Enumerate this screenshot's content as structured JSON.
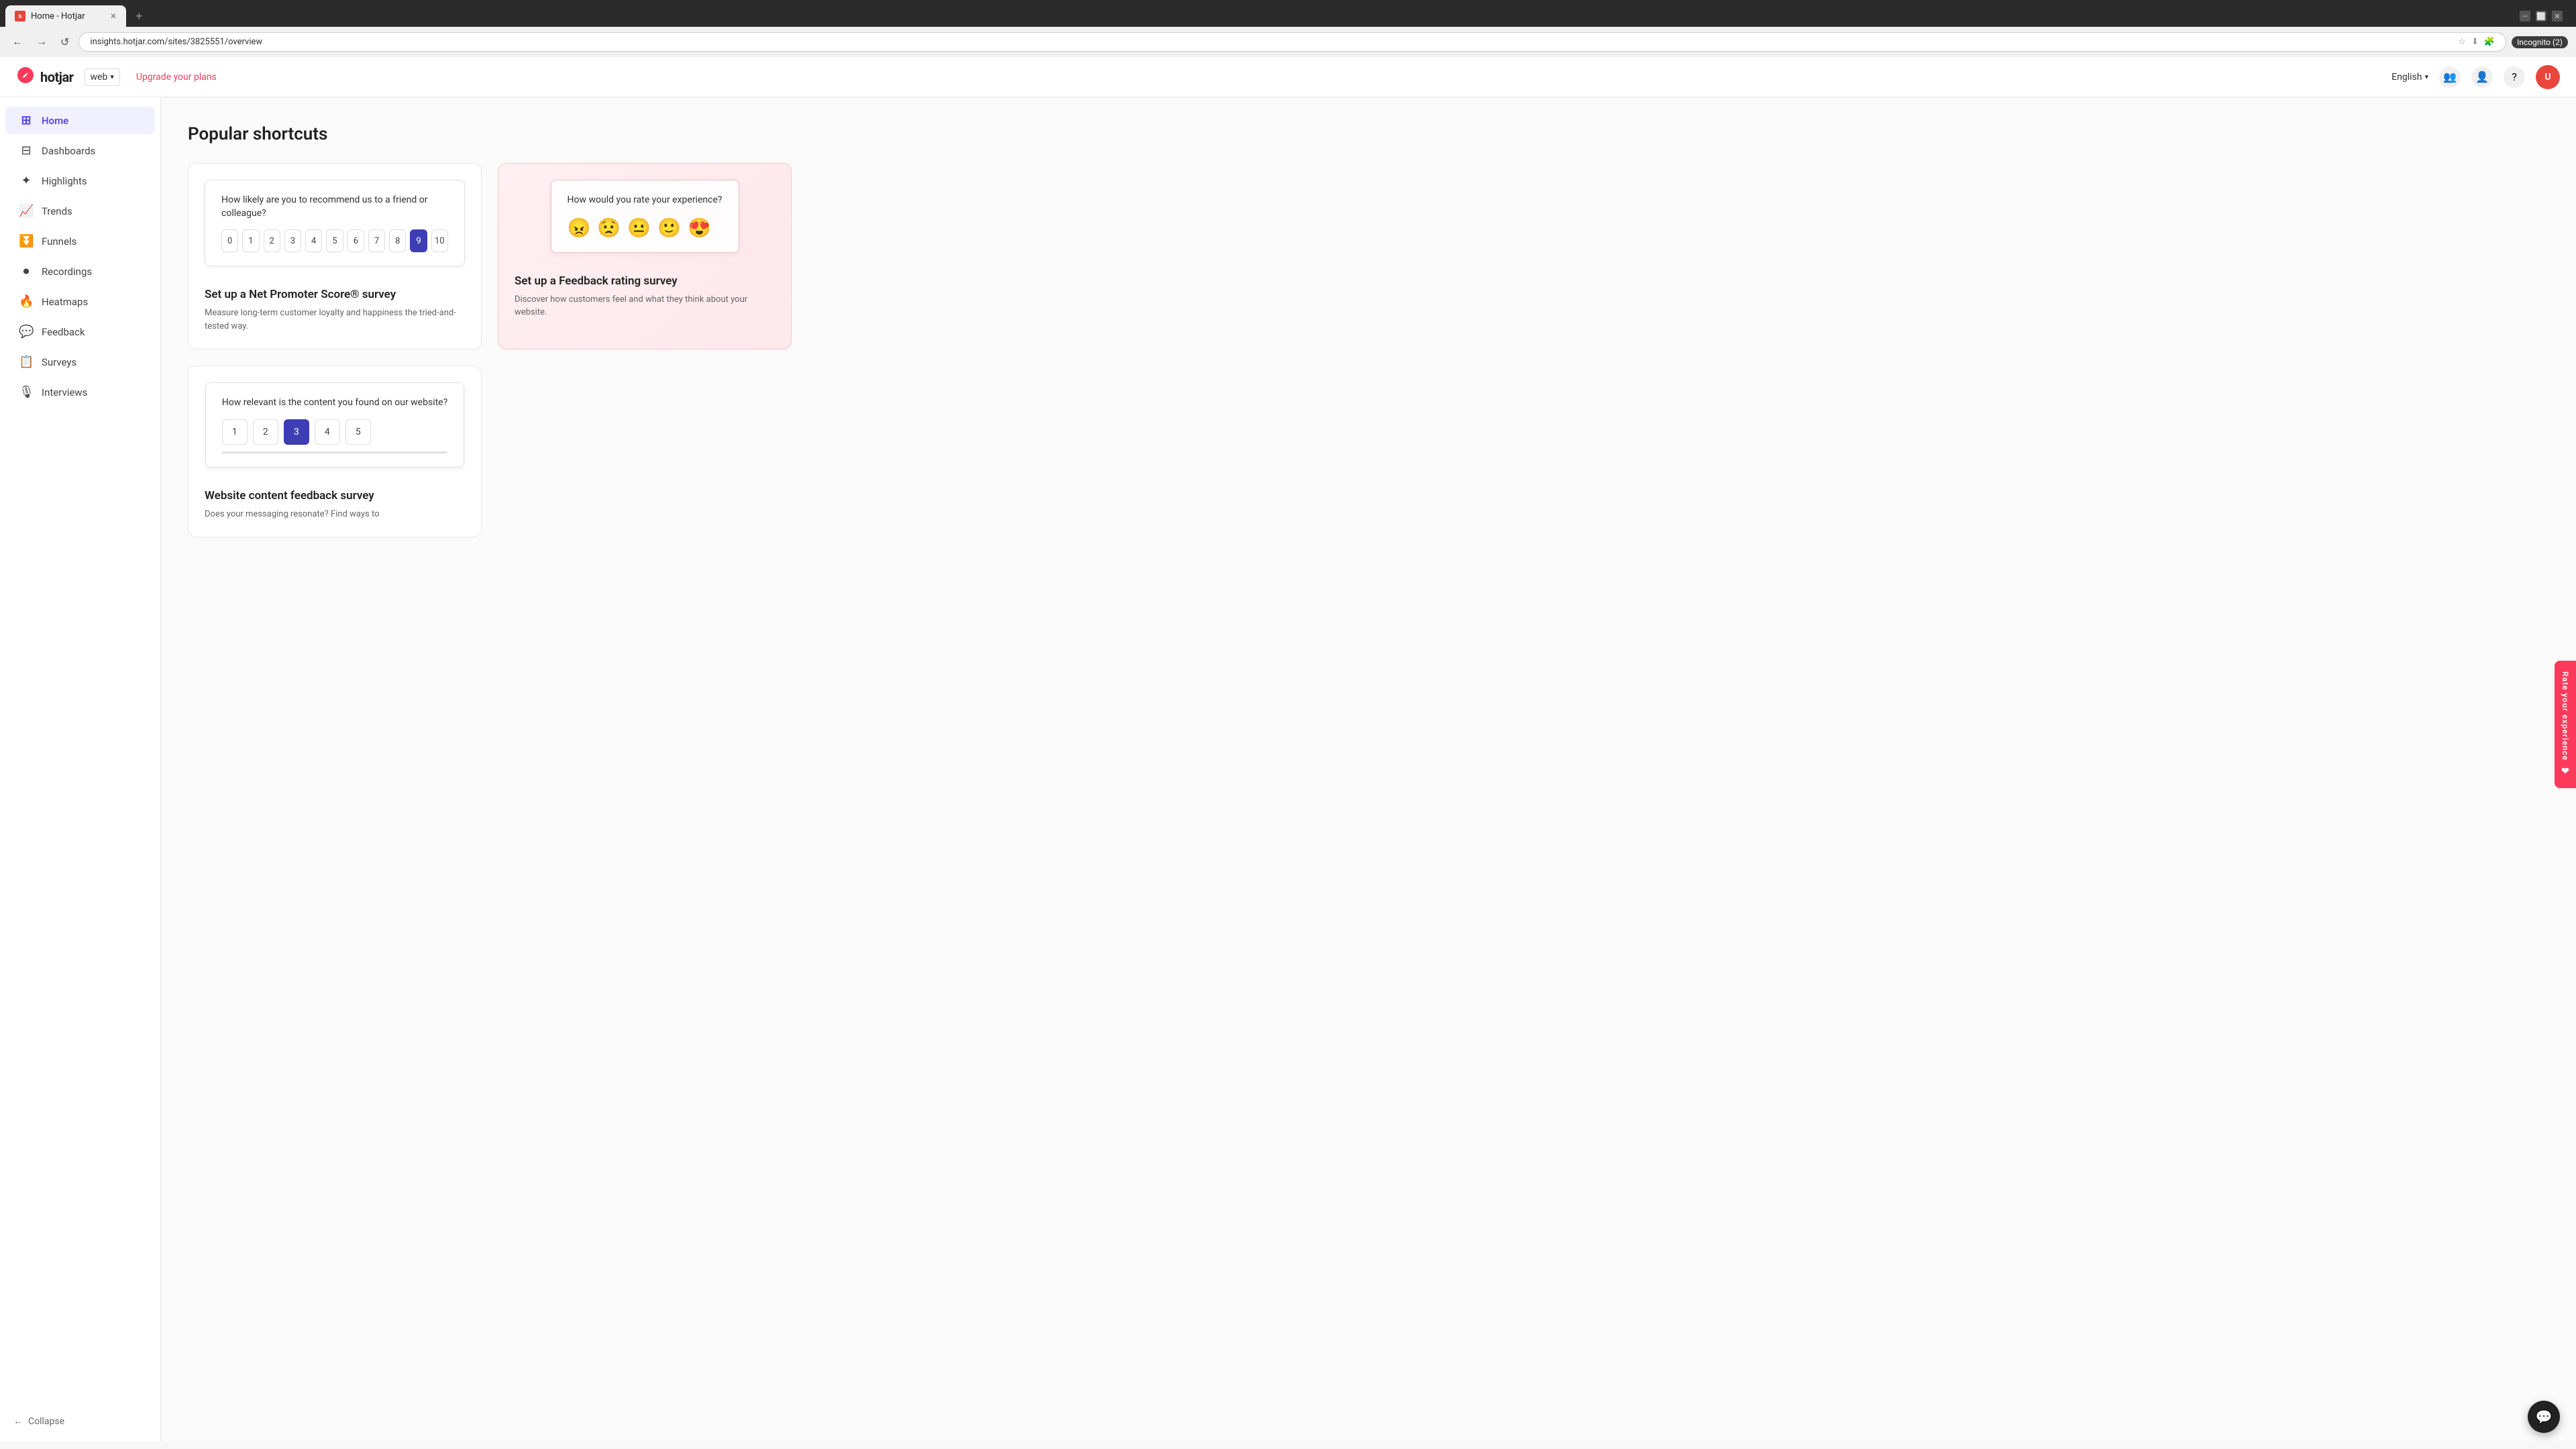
{
  "browser": {
    "tab_label": "Home - Hotjar",
    "url": "insights.hotjar.com/sites/3825551/overview",
    "incognito_label": "Incognito (2)",
    "new_tab_icon": "+"
  },
  "header": {
    "logo_text": "hotjar",
    "web_label": "web",
    "upgrade_label": "Upgrade your plans",
    "lang_label": "English",
    "avatar_initials": "U"
  },
  "sidebar": {
    "items": [
      {
        "label": "Home",
        "icon": "⊞",
        "active": true
      },
      {
        "label": "Dashboards",
        "icon": "⊟"
      },
      {
        "label": "Highlights",
        "icon": "✦"
      },
      {
        "label": "Trends",
        "icon": "📈"
      },
      {
        "label": "Funnels",
        "icon": "⏬"
      },
      {
        "label": "Recordings",
        "icon": "⏺"
      },
      {
        "label": "Heatmaps",
        "icon": "🔥"
      },
      {
        "label": "Feedback",
        "icon": "💬"
      },
      {
        "label": "Surveys",
        "icon": "📋"
      },
      {
        "label": "Interviews",
        "icon": "🎙"
      }
    ],
    "collapse_label": "Collapse"
  },
  "content": {
    "page_title": "Popular shortcuts",
    "cards": [
      {
        "id": "nps",
        "title": "Set up a Net Promoter Score® survey",
        "description": "Measure long-term customer loyalty and happiness the tried-and-tested way.",
        "preview_question": "How likely are you to recommend us to a friend or colleague?",
        "type": "nps",
        "nps_numbers": [
          "0",
          "1",
          "2",
          "3",
          "4",
          "5",
          "6",
          "7",
          "8",
          "9",
          "10"
        ],
        "selected_index": 9,
        "pink_bg": false
      },
      {
        "id": "feedback-rating",
        "title": "Set up a Feedback rating survey",
        "description": "Discover how customers feel and what they think about your website.",
        "preview_question": "How would you rate your experience?",
        "type": "emoji",
        "emojis": [
          "😠",
          "😟",
          "😐",
          "🙂",
          "😍"
        ],
        "pink_bg": true
      },
      {
        "id": "content-feedback",
        "title": "Website content feedback survey",
        "description": "Does your messaging resonate? Find ways to",
        "preview_question": "How relevant is the content you found on our website?",
        "type": "likert",
        "likert_numbers": [
          "1",
          "2",
          "3",
          "4",
          "5"
        ],
        "selected_index": 2,
        "pink_bg": false
      }
    ]
  },
  "rate_experience": {
    "label": "Rate your experience"
  },
  "chat": {
    "icon": "💬"
  }
}
